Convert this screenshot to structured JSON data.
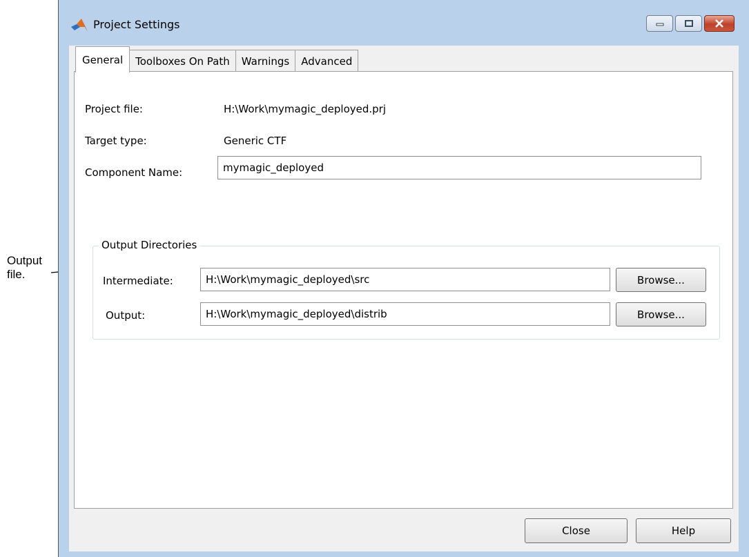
{
  "annotation": {
    "line1": "Output",
    "line2": "file."
  },
  "window": {
    "title": "Project Settings",
    "controls": [
      "minimize-icon",
      "maximize-icon",
      "close-icon"
    ]
  },
  "tabs": [
    {
      "label": "General",
      "active": true
    },
    {
      "label": "Toolboxes On Path",
      "active": false
    },
    {
      "label": "Warnings",
      "active": false
    },
    {
      "label": "Advanced",
      "active": false
    }
  ],
  "general": {
    "project_file_label": "Project file:",
    "project_file_value": "H:\\Work\\mymagic_deployed.prj",
    "target_type_label": "Target type:",
    "target_type_value": "Generic CTF",
    "component_name_label": "Component Name:",
    "component_name_value": "mymagic_deployed"
  },
  "output_directories": {
    "title": "Output Directories",
    "intermediate_label": "Intermediate:",
    "intermediate_value": "H:\\Work\\mymagic_deployed\\src",
    "output_label": "Output:",
    "output_value": "H:\\Work\\mymagic_deployed\\distrib",
    "browse_label": "Browse..."
  },
  "footer": {
    "close_label": "Close",
    "help_label": "Help"
  }
}
